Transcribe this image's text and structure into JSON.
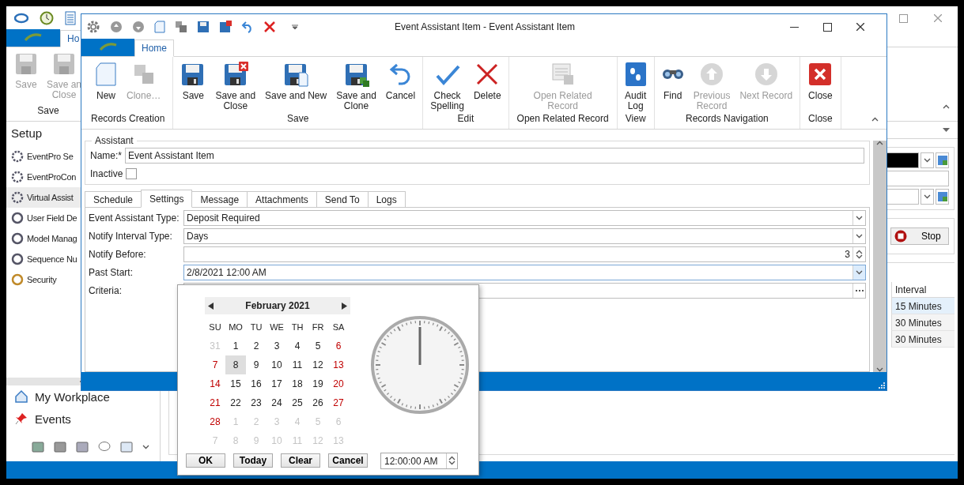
{
  "background_window": {
    "tabs": [
      {
        "label": "Ho",
        "selected": true
      }
    ],
    "ribbon": {
      "buttons": [
        {
          "label": "Save",
          "disabled": true
        },
        {
          "label": "Save an\nClose",
          "disabled": true
        }
      ],
      "group": "Save"
    },
    "sidebar": {
      "title": "Setup",
      "items": [
        {
          "label": "EventPro Se",
          "selected": false
        },
        {
          "label": "EventProCon",
          "selected": false
        },
        {
          "label": "Virtual Assist",
          "selected": true
        },
        {
          "label": "User Field De",
          "selected": false
        },
        {
          "label": "Model Manag",
          "selected": false
        },
        {
          "label": "Sequence Nu",
          "selected": false
        },
        {
          "label": "Security",
          "selected": false
        }
      ]
    },
    "nav": [
      {
        "label": "My Workplace"
      },
      {
        "label": "Events"
      }
    ],
    "stop_button": "Stop",
    "table": {
      "columns": [
        "Interval"
      ],
      "rows": [
        {
          "cells": [
            "15 Minutes"
          ],
          "selected": true
        },
        {
          "cells": [
            "30 Minutes"
          ],
          "selected": false
        },
        {
          "cells": [
            "30 Minutes"
          ],
          "selected": false
        }
      ]
    }
  },
  "dialog": {
    "title": "Event Assistant Item - Event Assistant Item",
    "tabs": [
      {
        "label": "Home",
        "selected": true
      }
    ],
    "ribbon_groups": [
      {
        "label": "Records Creation",
        "buttons": [
          {
            "label": "New",
            "disabled": false
          },
          {
            "label": "Clone…",
            "disabled": true
          }
        ]
      },
      {
        "label": "Save",
        "buttons": [
          {
            "label": "Save",
            "disabled": false
          },
          {
            "label": "Save and\nClose",
            "disabled": false
          },
          {
            "label": "Save and New",
            "disabled": false
          },
          {
            "label": "Save and\nClone",
            "disabled": false
          },
          {
            "label": "Cancel",
            "disabled": false
          }
        ]
      },
      {
        "label": "Edit",
        "buttons": [
          {
            "label": "Check\nSpelling",
            "disabled": false
          },
          {
            "label": "Delete",
            "disabled": false
          }
        ]
      },
      {
        "label": "Open Related Record",
        "buttons": [
          {
            "label": "Open Related\nRecord",
            "disabled": true
          }
        ]
      },
      {
        "label": "View",
        "buttons": [
          {
            "label": "Audit\nLog",
            "disabled": false
          }
        ]
      },
      {
        "label": "Records Navigation",
        "buttons": [
          {
            "label": "Find",
            "disabled": false
          },
          {
            "label": "Previous\nRecord",
            "disabled": true
          },
          {
            "label": "Next Record",
            "disabled": true
          }
        ]
      },
      {
        "label": "Close",
        "buttons": [
          {
            "label": "Close",
            "disabled": false
          }
        ]
      }
    ],
    "assistant": {
      "title": "Assistant",
      "name_label": "Name:*",
      "name_value": "Event Assistant Item",
      "inactive_label": "Inactive",
      "inactive_checked": false
    },
    "form_tabs": [
      {
        "label": "Schedule",
        "selected": false
      },
      {
        "label": "Settings",
        "selected": true
      },
      {
        "label": "Message",
        "selected": false
      },
      {
        "label": "Attachments",
        "selected": false
      },
      {
        "label": "Send To",
        "selected": false
      },
      {
        "label": "Logs",
        "selected": false
      }
    ],
    "fields": [
      {
        "label": "Event Assistant Type:",
        "value": "Deposit Required",
        "kind": "combo"
      },
      {
        "label": "Notify Interval Type:",
        "value": "Days",
        "kind": "combo"
      },
      {
        "label": "Notify Before:",
        "value": "3",
        "kind": "spin"
      },
      {
        "label": "Past Start:",
        "value": "2/8/2021 12:00 AM",
        "kind": "date"
      },
      {
        "label": "Criteria:",
        "kind": "ellipsis"
      }
    ]
  },
  "date_popup": {
    "month": "February 2021",
    "weekdays": [
      "SU",
      "MO",
      "TU",
      "WE",
      "TH",
      "FR",
      "SA"
    ],
    "weeks": [
      [
        {
          "day": "31",
          "kind": "other",
          "selected": false
        },
        {
          "day": "1",
          "kind": "normal",
          "selected": false
        },
        {
          "day": "2",
          "kind": "normal",
          "selected": false
        },
        {
          "day": "3",
          "kind": "normal",
          "selected": false
        },
        {
          "day": "4",
          "kind": "normal",
          "selected": false
        },
        {
          "day": "5",
          "kind": "normal",
          "selected": false
        },
        {
          "day": "6",
          "kind": "weekend",
          "selected": false
        }
      ],
      [
        {
          "day": "7",
          "kind": "weekend",
          "selected": false
        },
        {
          "day": "8",
          "kind": "normal",
          "selected": true
        },
        {
          "day": "9",
          "kind": "normal",
          "selected": false
        },
        {
          "day": "10",
          "kind": "normal",
          "selected": false
        },
        {
          "day": "11",
          "kind": "normal",
          "selected": false
        },
        {
          "day": "12",
          "kind": "normal",
          "selected": false
        },
        {
          "day": "13",
          "kind": "weekend",
          "selected": false
        }
      ],
      [
        {
          "day": "14",
          "kind": "weekend",
          "selected": false
        },
        {
          "day": "15",
          "kind": "normal",
          "selected": false
        },
        {
          "day": "16",
          "kind": "normal",
          "selected": false
        },
        {
          "day": "17",
          "kind": "normal",
          "selected": false
        },
        {
          "day": "18",
          "kind": "normal",
          "selected": false
        },
        {
          "day": "19",
          "kind": "normal",
          "selected": false
        },
        {
          "day": "20",
          "kind": "weekend",
          "selected": false
        }
      ],
      [
        {
          "day": "21",
          "kind": "weekend",
          "selected": false
        },
        {
          "day": "22",
          "kind": "normal",
          "selected": false
        },
        {
          "day": "23",
          "kind": "normal",
          "selected": false
        },
        {
          "day": "24",
          "kind": "normal",
          "selected": false
        },
        {
          "day": "25",
          "kind": "normal",
          "selected": false
        },
        {
          "day": "26",
          "kind": "normal",
          "selected": false
        },
        {
          "day": "27",
          "kind": "weekend",
          "selected": false
        }
      ],
      [
        {
          "day": "28",
          "kind": "weekend",
          "selected": false
        },
        {
          "day": "1",
          "kind": "other",
          "selected": false
        },
        {
          "day": "2",
          "kind": "other",
          "selected": false
        },
        {
          "day": "3",
          "kind": "other",
          "selected": false
        },
        {
          "day": "4",
          "kind": "other",
          "selected": false
        },
        {
          "day": "5",
          "kind": "other",
          "selected": false
        },
        {
          "day": "6",
          "kind": "other",
          "selected": false
        }
      ],
      [
        {
          "day": "7",
          "kind": "other",
          "selected": false
        },
        {
          "day": "8",
          "kind": "other",
          "selected": false
        },
        {
          "day": "9",
          "kind": "other",
          "selected": false
        },
        {
          "day": "10",
          "kind": "other",
          "selected": false
        },
        {
          "day": "11",
          "kind": "other",
          "selected": false
        },
        {
          "day": "12",
          "kind": "other",
          "selected": false
        },
        {
          "day": "13",
          "kind": "other",
          "selected": false
        }
      ]
    ],
    "buttons": [
      "OK",
      "Today",
      "Clear",
      "Cancel"
    ],
    "time": "12:00:00 AM"
  }
}
